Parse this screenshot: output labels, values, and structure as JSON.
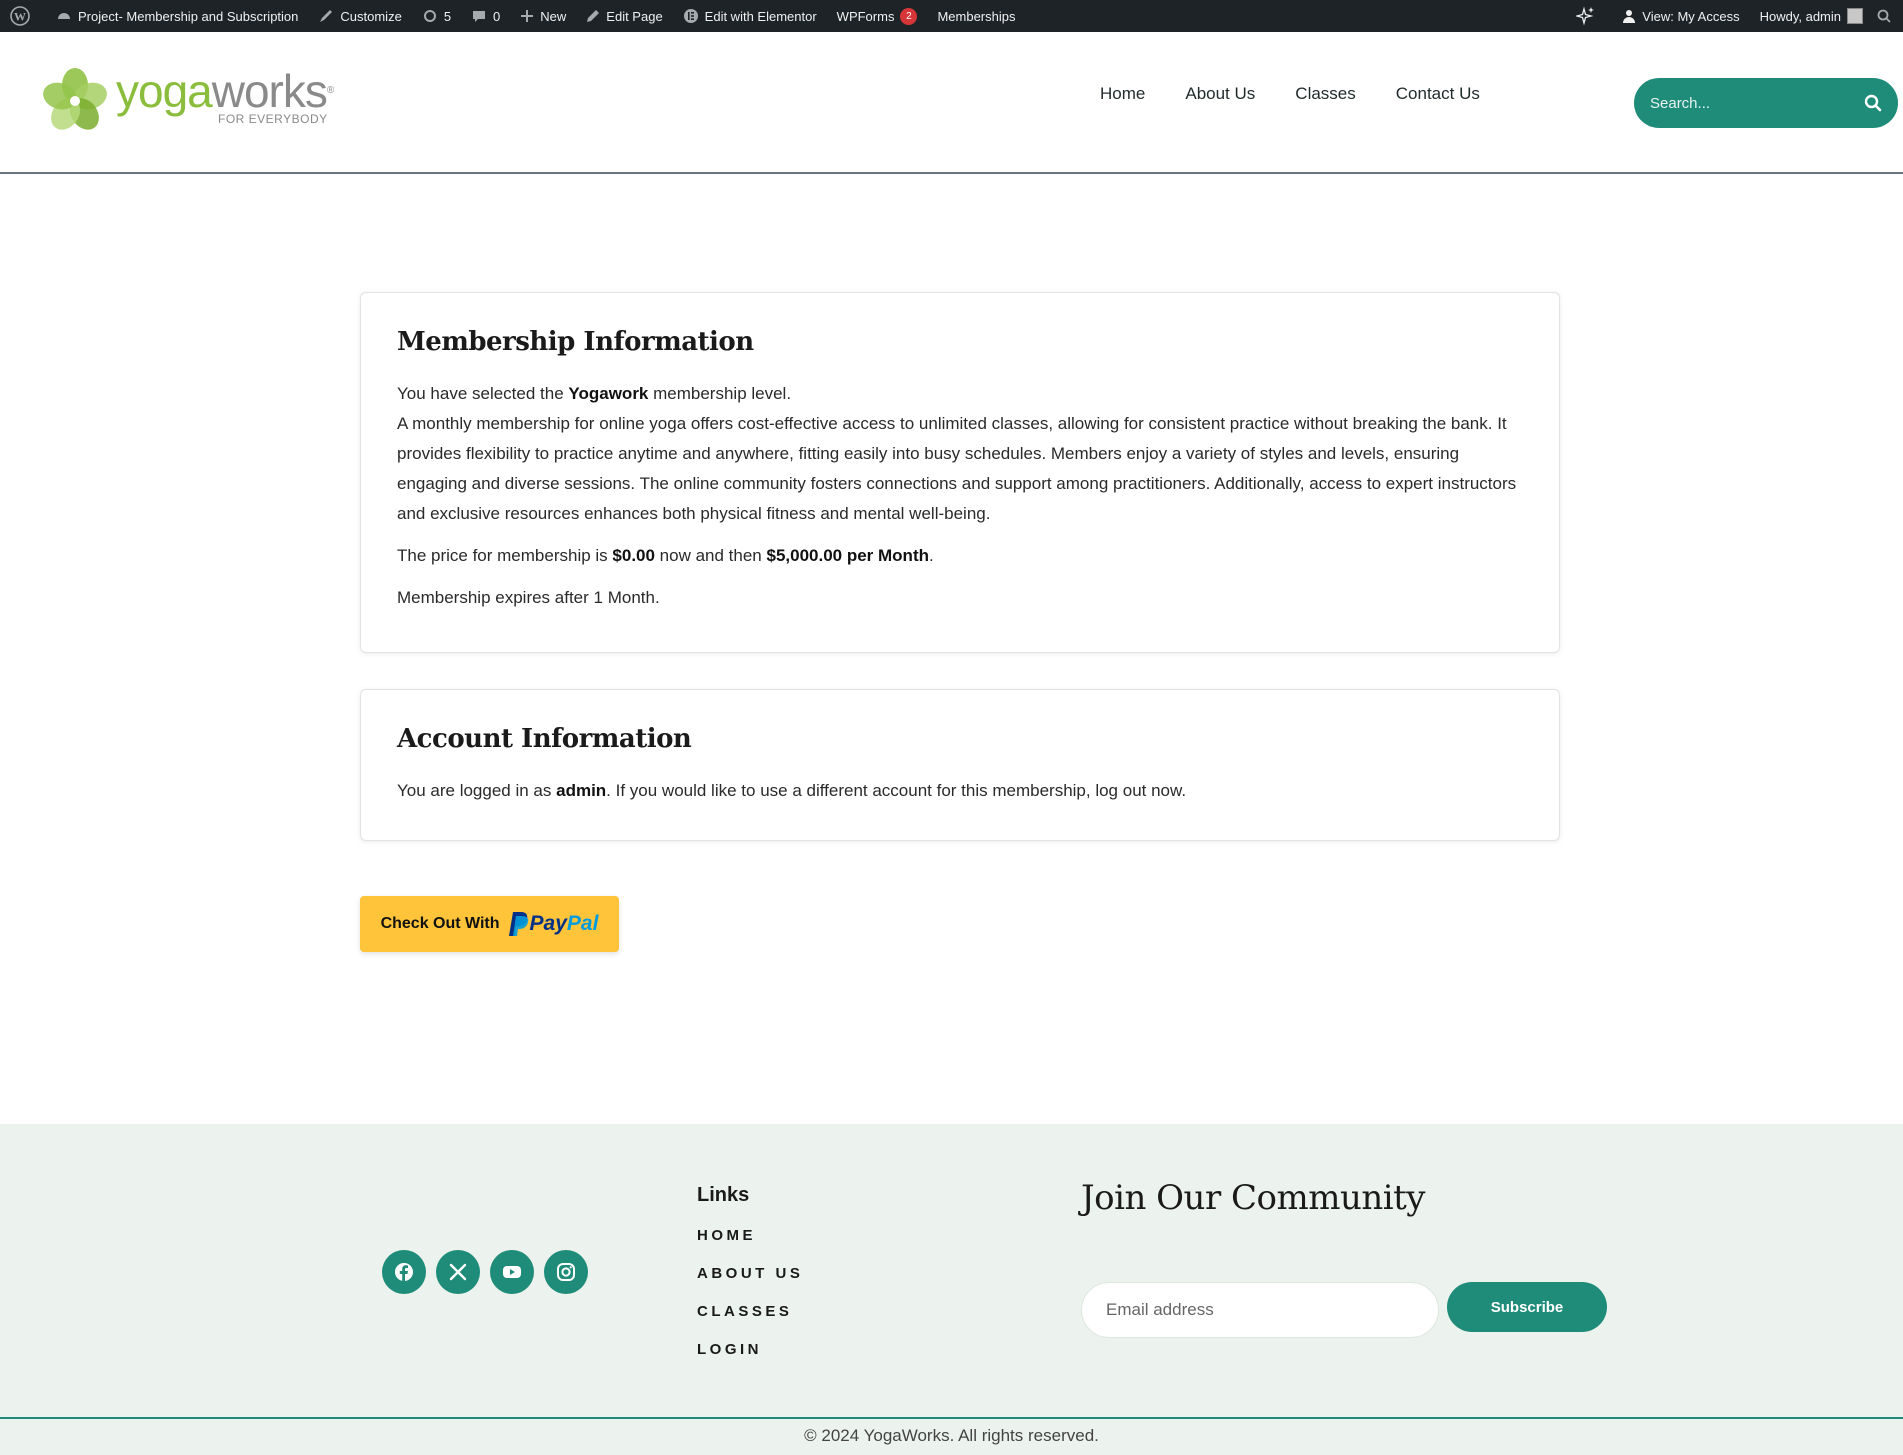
{
  "admin_bar": {
    "site_name": "Project- Membership and Subscription",
    "customize": "Customize",
    "updates_count": "5",
    "comments_count": "0",
    "new": "New",
    "edit_page": "Edit Page",
    "edit_elementor": "Edit with Elementor",
    "wpforms": "WPForms",
    "wpforms_badge": "2",
    "memberships": "Memberships",
    "view_access": "View: My Access",
    "howdy": "Howdy, admin"
  },
  "header": {
    "logo_word_1": "yoga",
    "logo_word_2": "works",
    "logo_tagline": "FOR EVERYBODY",
    "nav": [
      "Home",
      "About Us",
      "Classes",
      "Contact Us"
    ],
    "search_placeholder": "Search..."
  },
  "membership_card": {
    "title": "Membership Information",
    "selected_prefix": "You have selected the ",
    "level_name": "Yogawork",
    "selected_suffix": " membership level.",
    "description": "A monthly membership for online yoga offers cost-effective access to unlimited classes, allowing for consistent practice without breaking the bank. It provides flexibility to practice anytime and anywhere, fitting easily into busy schedules. Members enjoy a variety of styles and levels, ensuring engaging and diverse sessions. The online community fosters connections and support among practitioners. Additionally, access to expert instructors and exclusive resources enhances both physical fitness and mental well-being.",
    "price_prefix": "The price for membership is ",
    "price_now": "$0.00",
    "price_mid": " now and then ",
    "price_recurring": "$5,000.00 per Month",
    "price_end": ".",
    "expires": "Membership expires after 1 Month."
  },
  "account_card": {
    "title": "Account Information",
    "logged_prefix": "You are logged in as ",
    "username": "admin",
    "logged_suffix": ". If you would like to use a different account for this membership, log out now."
  },
  "checkout": {
    "label": "Check Out With",
    "brand_1": "Pay",
    "brand_2": "Pal",
    "brand_color": "#ffc439"
  },
  "footer": {
    "social": [
      "facebook-icon",
      "x-icon",
      "youtube-icon",
      "instagram-icon"
    ],
    "links_title": "Links",
    "links": [
      "HOME",
      "ABOUT US",
      "CLASSES",
      "LOGIN"
    ],
    "join_title": "Join Our Community",
    "email_placeholder": "Email address",
    "subscribe_label": "Subscribe",
    "copyright": "© 2024 YogaWorks. All rights reserved."
  },
  "colors": {
    "accent": "#1f8c7a",
    "logo_green": "#8bbd3c",
    "footer_bg": "#ecf3ee",
    "admin_bar": "#1d2327"
  }
}
